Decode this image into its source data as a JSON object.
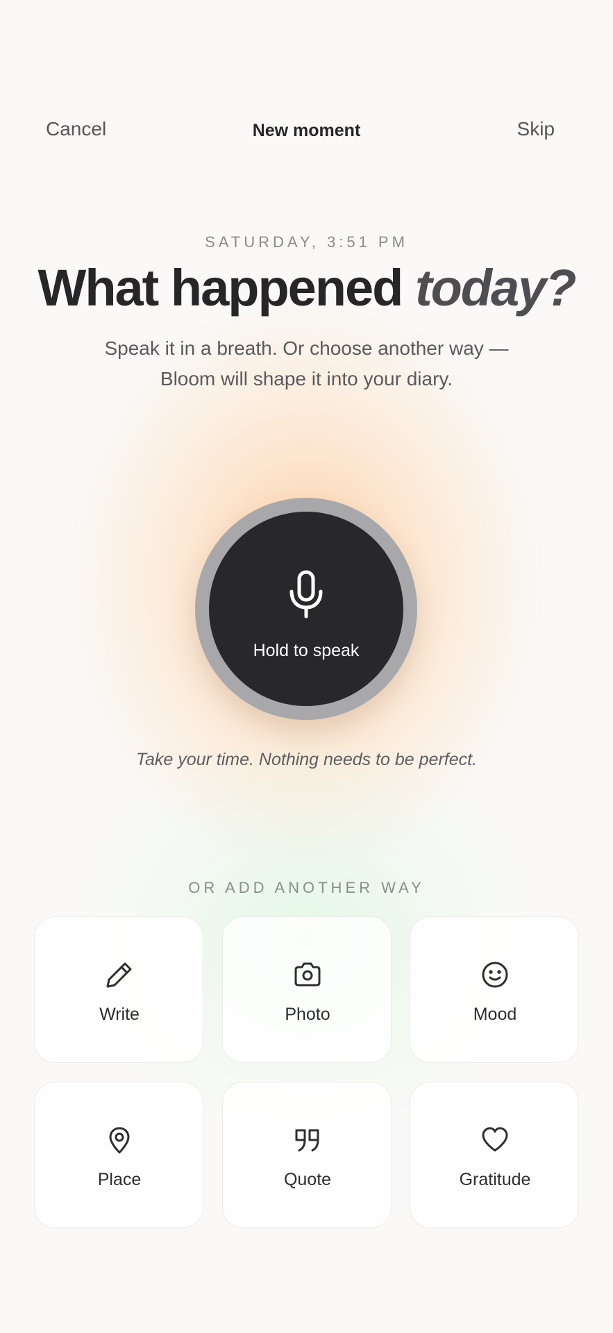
{
  "header": {
    "cancel_label": "Cancel",
    "title": "New moment",
    "skip_label": "Skip"
  },
  "prompt": {
    "date": "SATURDAY, 3:51 PM",
    "headline_main": "What happened",
    "headline_emphasis": "today?",
    "subtitle_line1": "Speak it in a breath. Or choose another way —",
    "subtitle_line2": "Bloom will shape it into your diary."
  },
  "record": {
    "label": "Hold to speak",
    "icon": "microphone-icon",
    "hint": "Take your time. Nothing needs to be perfect."
  },
  "options": {
    "heading": "OR ADD ANOTHER WAY",
    "items": [
      {
        "label": "Write",
        "icon": "pencil-icon"
      },
      {
        "label": "Photo",
        "icon": "camera-icon"
      },
      {
        "label": "Mood",
        "icon": "smiley-icon"
      },
      {
        "label": "Place",
        "icon": "map-pin-icon"
      },
      {
        "label": "Quote",
        "icon": "quote-icon"
      },
      {
        "label": "Gratitude",
        "icon": "heart-icon"
      }
    ]
  },
  "colors": {
    "background": "#faf9f7",
    "text_primary": "#262628",
    "mic_button": "#28282a",
    "mic_ring": "#a8a8aa",
    "glow_warm": "#ffc48c",
    "glow_green": "#c8f5d2"
  }
}
